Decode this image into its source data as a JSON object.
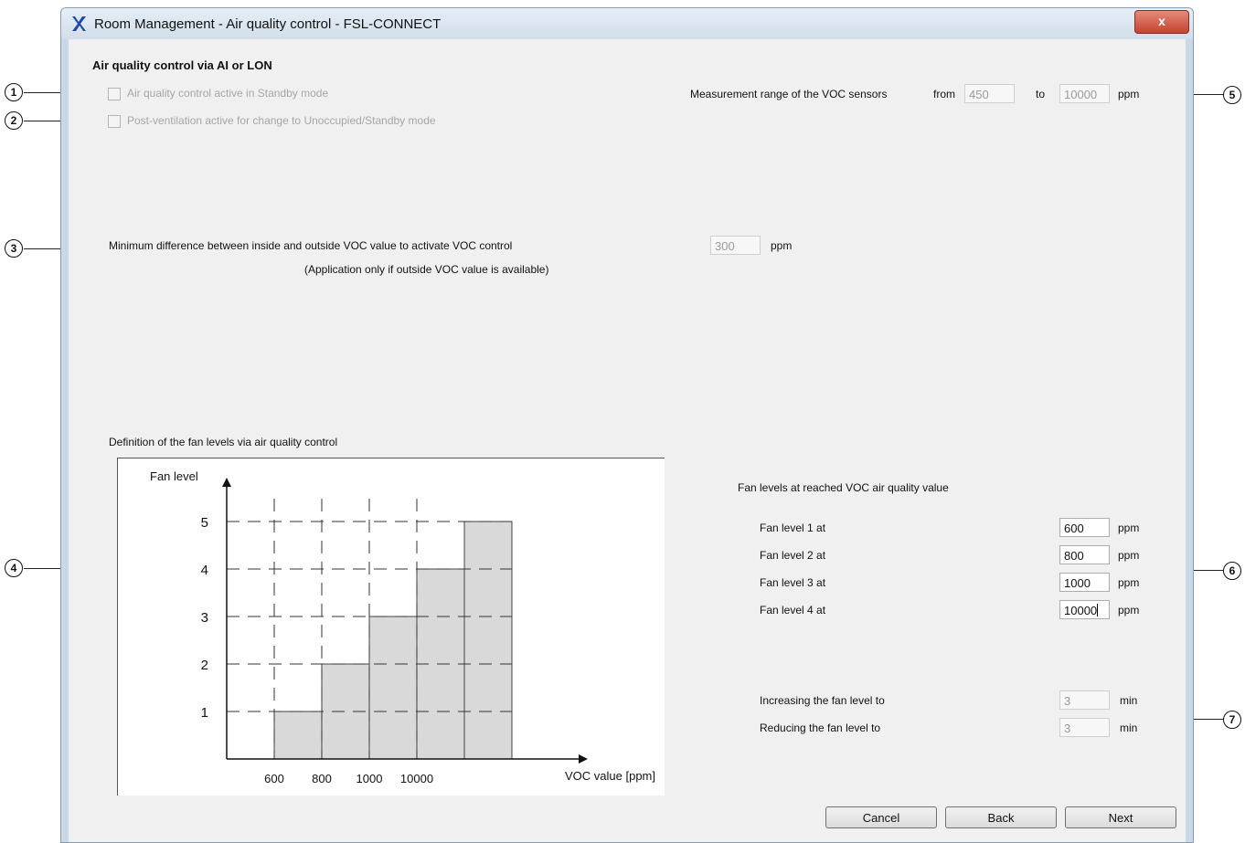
{
  "window": {
    "title": "Room Management - Air quality control  -  FSL-CONNECT",
    "close_label": "x"
  },
  "callouts": [
    "1",
    "2",
    "3",
    "4",
    "5",
    "6",
    "7"
  ],
  "section_title": "Air quality control via AI or LON",
  "checkboxes": [
    {
      "label": "Air quality control active in Standby mode",
      "checked": false,
      "enabled": false
    },
    {
      "label": "Post-ventilation active for change to Unoccupied/Standby mode",
      "checked": false,
      "enabled": false
    }
  ],
  "measurement": {
    "label": "Measurement range of the VOC sensors",
    "from_label": "from",
    "from_value": "450",
    "to_label": "to",
    "to_value": "10000",
    "unit": "ppm"
  },
  "min_diff": {
    "label": "Minimum difference between inside and outside VOC value to activate VOC control",
    "note": "(Application only if outside VOC value is available)",
    "value": "300",
    "unit": "ppm"
  },
  "chart_caption": "Definition of the fan levels via air quality control",
  "chart_data": {
    "type": "bar",
    "title": "",
    "xlabel": "VOC value [ppm]",
    "ylabel": "Fan level",
    "categories": [
      "600",
      "800",
      "1000",
      "10000",
      ""
    ],
    "values": [
      1,
      2,
      3,
      4,
      5
    ],
    "y_ticks": [
      1,
      2,
      3,
      4,
      5
    ],
    "ylim": [
      0,
      5
    ],
    "grid": "dashed",
    "fill_color": "#d9d9d9"
  },
  "fan_levels": {
    "heading": "Fan levels at reached VOC air quality value",
    "unit": "ppm",
    "rows": [
      {
        "label": "Fan level 1 at",
        "value": "600"
      },
      {
        "label": "Fan level 2 at",
        "value": "800"
      },
      {
        "label": "Fan level 3 at",
        "value": "1000"
      },
      {
        "label": "Fan level 4 at",
        "value": "10000"
      }
    ]
  },
  "delays": {
    "unit": "min",
    "rows": [
      {
        "label": "Increasing the fan level to",
        "value": "3"
      },
      {
        "label": "Reducing the fan level to",
        "value": "3"
      }
    ]
  },
  "buttons": {
    "cancel": "Cancel",
    "back": "Back",
    "next": "Next"
  }
}
